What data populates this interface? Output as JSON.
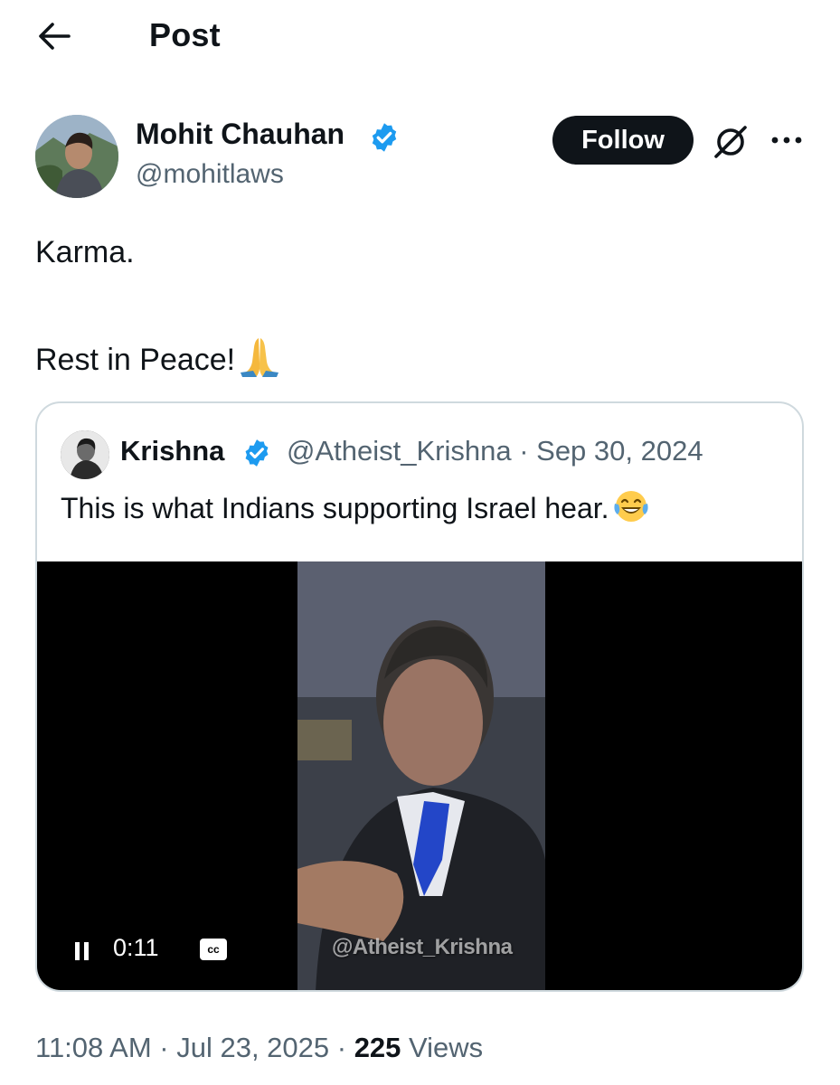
{
  "header": {
    "title": "Post"
  },
  "author": {
    "name": "Mohit Chauhan",
    "handle": "@mohitlaws",
    "follow_label": "Follow"
  },
  "post": {
    "line1": "Karma.",
    "line2": "Rest in Peace!"
  },
  "quote": {
    "name": "Krishna",
    "handle_date": "@Atheist_Krishna · Sep 30, 2024",
    "text": "This is what Indians supporting Israel hear."
  },
  "video": {
    "time": "0:11",
    "cc_label": "cc",
    "watermark": "@Atheist_Krishna"
  },
  "footer": {
    "time_date": "11:08 AM · Jul 23, 2025 · ",
    "view_count": "225",
    "views_label": " Views"
  },
  "colors": {
    "text_primary": "#0f1419",
    "text_secondary": "#536471",
    "verified_blue": "#1d9bf0",
    "border": "#cfd9de"
  }
}
